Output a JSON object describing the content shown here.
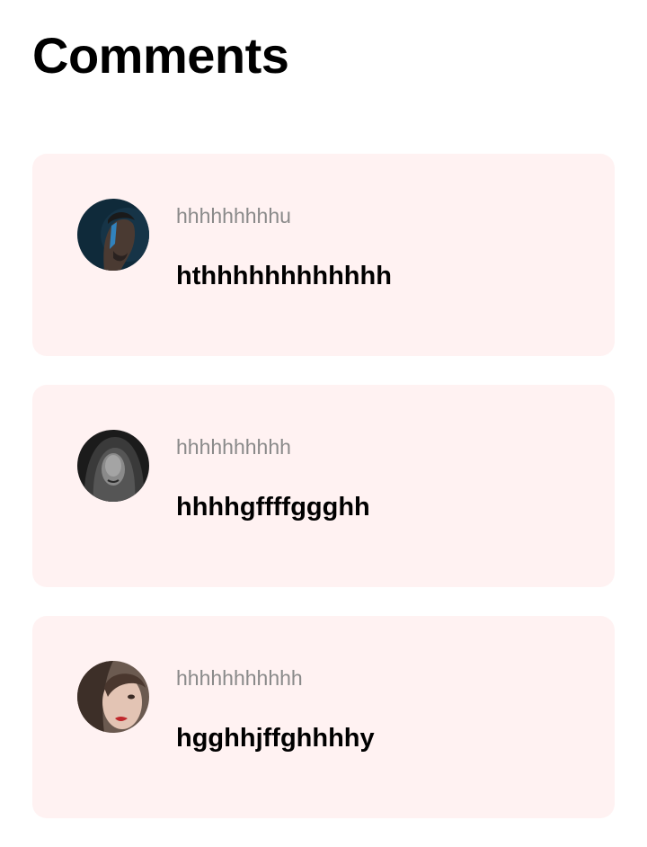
{
  "header": {
    "title": "Comments"
  },
  "theme": {
    "card_background": "#fff2f2",
    "author_color": "#8a8a8a",
    "text_color": "#000000"
  },
  "comments": [
    {
      "author": "hhhhhhhhhu",
      "text": "hthhhhhhhhhhhh",
      "avatar_icon": "avatar-man-blue-facepaint-photo"
    },
    {
      "author": "hhhhhhhhhh",
      "text": "hhhhgffffggghh",
      "avatar_icon": "avatar-woman-hood-monochrome-photo"
    },
    {
      "author": "hhhhhhhhhhh",
      "text": "hgghhjffghhhhy",
      "avatar_icon": "avatar-woman-red-lips-photo"
    }
  ]
}
